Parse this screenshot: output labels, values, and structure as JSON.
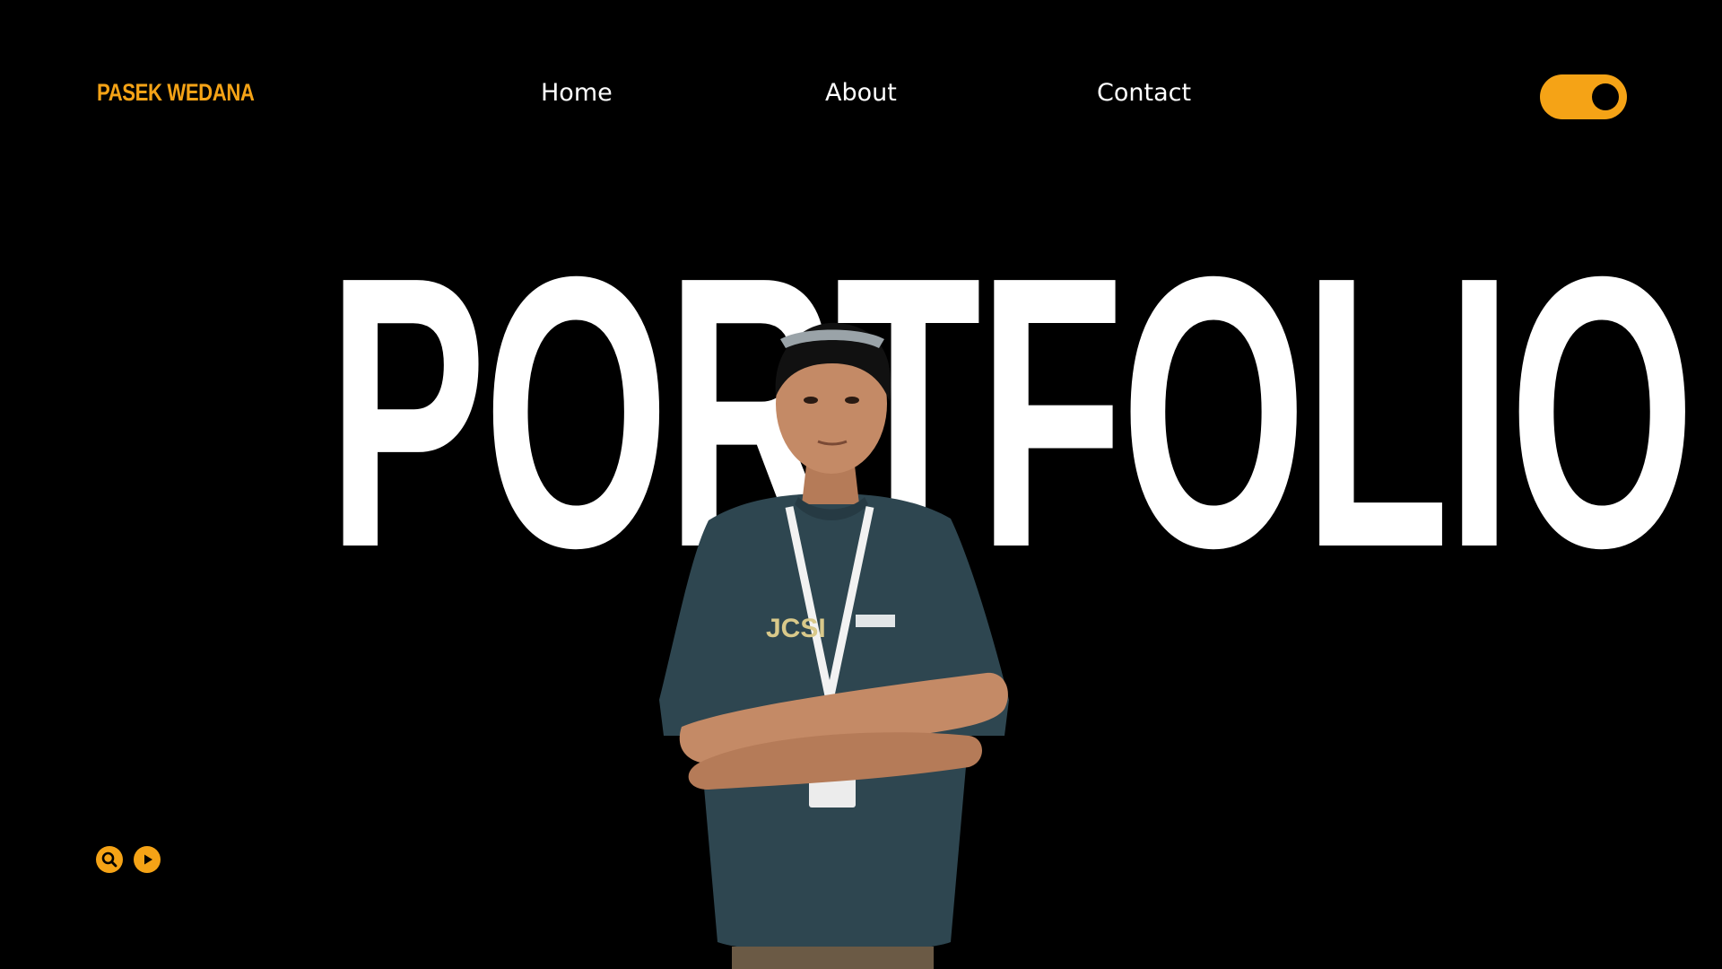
{
  "header": {
    "brand": "PASEK WEDANA",
    "nav": [
      {
        "label": "Home"
      },
      {
        "label": "About"
      },
      {
        "label": "Contact"
      }
    ],
    "theme_toggle": {
      "state": "on",
      "icon": "toggle-switch-icon"
    }
  },
  "hero": {
    "title": "PORTFOLIO",
    "portrait": {
      "icon": "person-portrait",
      "shirt_print": "JCSI"
    }
  },
  "controls": [
    {
      "icon": "search-icon"
    },
    {
      "icon": "play-icon"
    }
  ],
  "colors": {
    "accent": "#F5A316",
    "background": "#000000",
    "text": "#FFFFFF",
    "shirt": "#2E4650",
    "skin": "#C48A66"
  }
}
